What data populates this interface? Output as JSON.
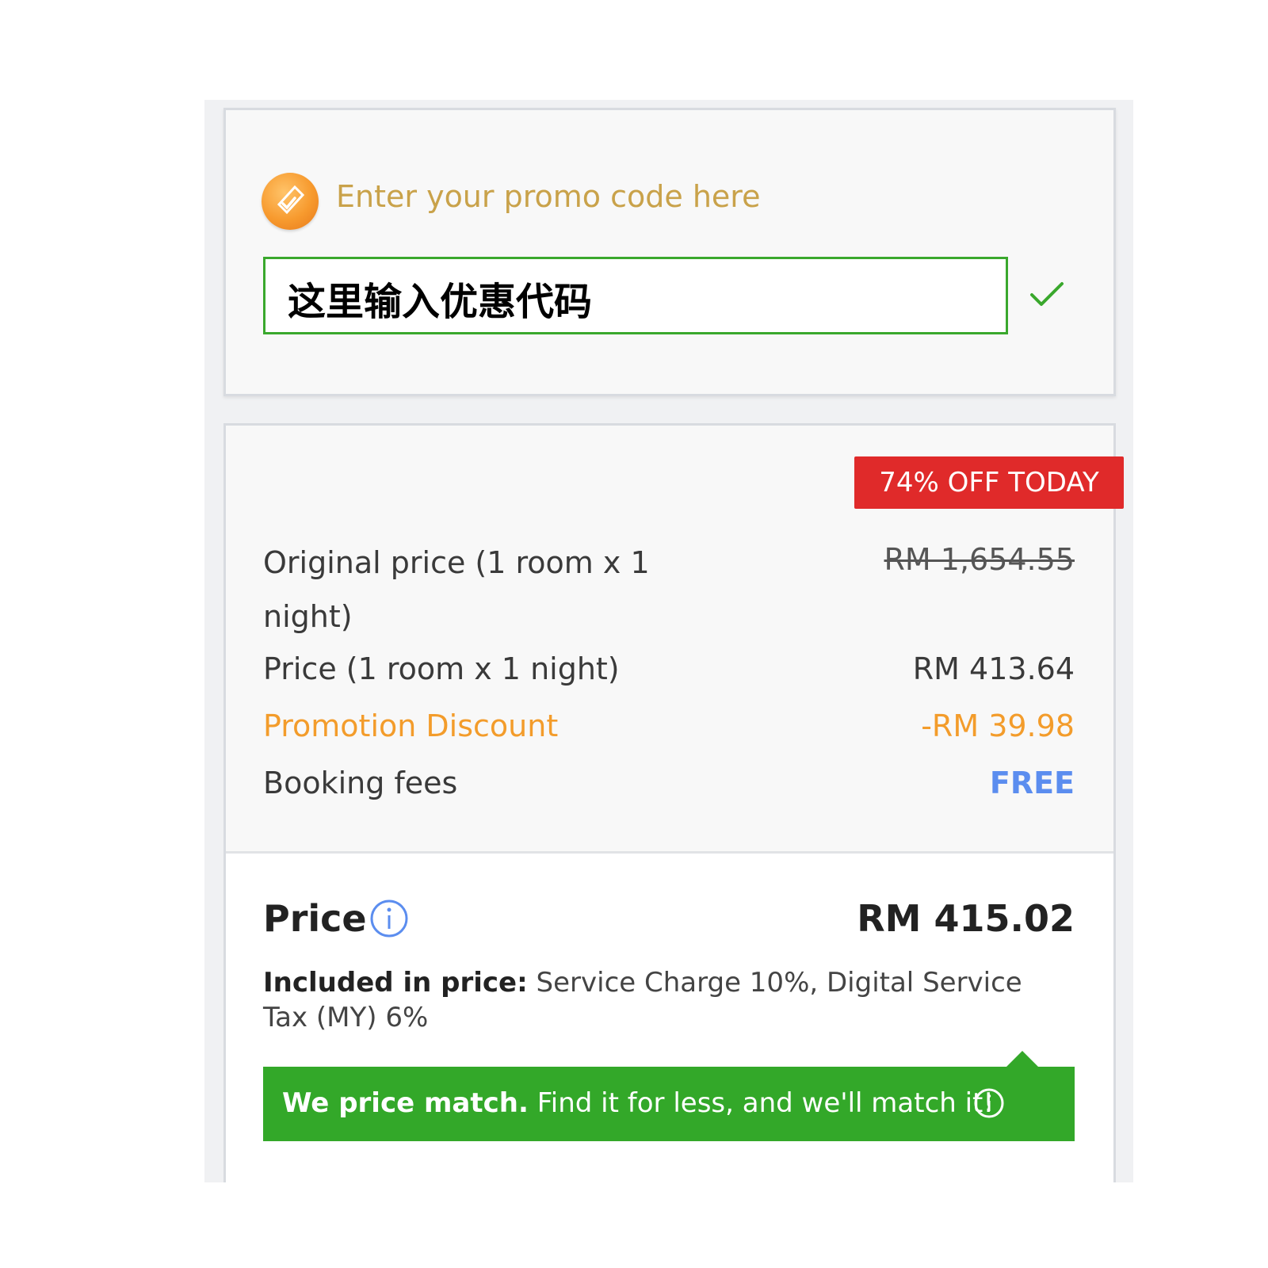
{
  "promo": {
    "title": "Enter your promo code here",
    "input_value": "这里输入优惠代码",
    "icon": "promo-tag-icon",
    "confirm_icon": "checkmark-icon"
  },
  "badge": {
    "label": "74% OFF TODAY"
  },
  "breakdown": {
    "original_label": "Original price (1 room x 1 night)",
    "original_value": "RM 1,654.55",
    "price_label": "Price (1 room x 1 night)",
    "price_value": "RM 413.64",
    "promo_label": "Promotion Discount",
    "promo_value": "-RM 39.98",
    "fees_label": "Booking fees",
    "fees_value": "FREE"
  },
  "total": {
    "label": "Price",
    "value": "RM 415.02",
    "included_label": "Included in price:",
    "included_text": " Service Charge 10%, Digital Service Tax (MY) 6%"
  },
  "price_match": {
    "bold": "We price match.",
    "text": " Find it for less, and we'll match it!"
  },
  "colors": {
    "accent_green": "#33a829",
    "badge_red": "#e02a2a",
    "promo_orange": "#f39c2b",
    "free_blue": "#5b8def",
    "title_gold": "#c9a24a"
  }
}
